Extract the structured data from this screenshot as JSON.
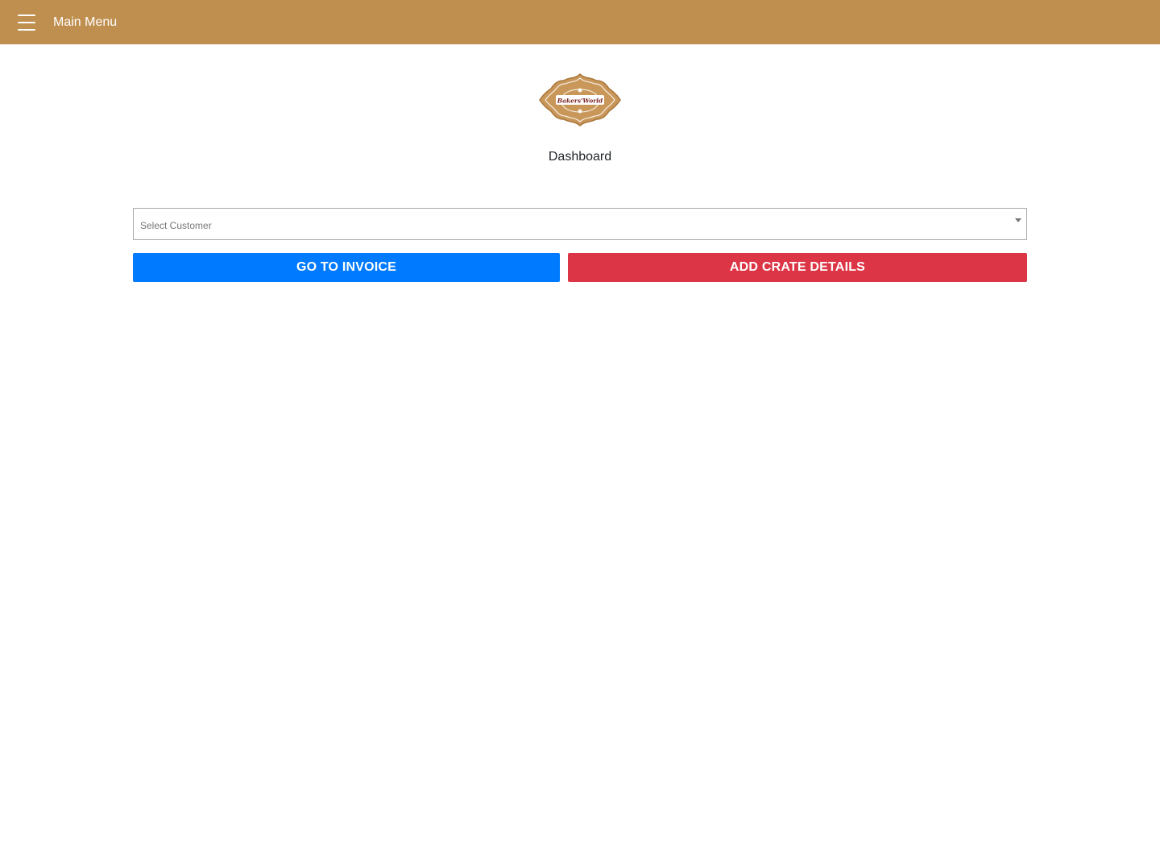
{
  "header": {
    "title": "Main Menu",
    "menu_icon": "hamburger-menu-icon",
    "background_color": "#bf8f4f"
  },
  "logo": {
    "text": "Bakers'World",
    "color": "#bf8f4f"
  },
  "main": {
    "page_title": "Dashboard",
    "customer_select": {
      "placeholder": "Select Customer",
      "selected_value": ""
    },
    "buttons": {
      "invoice_label": "GO TO INVOICE",
      "invoice_color": "#007bff",
      "crate_label": "ADD CRATE DETAILS",
      "crate_color": "#dc3545"
    }
  }
}
